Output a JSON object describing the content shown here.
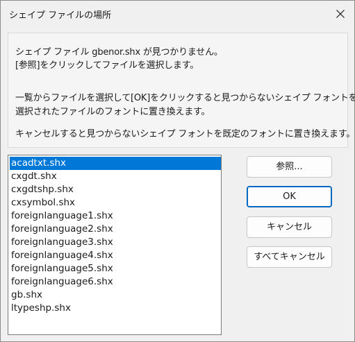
{
  "window": {
    "title": "シェイプ ファイルの場所",
    "close_icon": "close-icon"
  },
  "message": {
    "line1": "シェイプ ファイル gbenor.shx が見つかりません。",
    "line2": "[参照]をクリックしてファイルを選択します。",
    "line3": "一覧からファイルを選択して[OK]をクリックすると見つからないシェイプ フォントを",
    "line4": "選択されたファイルのフォントに置き換えます。",
    "line5": "キャンセルすると見つからないシェイプ フォントを既定のフォントに置き換えます。"
  },
  "file_list": {
    "items": [
      "acadtxt.shx",
      "cxgdt.shx",
      "cxgdtshp.shx",
      "cxsymbol.shx",
      "foreignlanguage1.shx",
      "foreignlanguage2.shx",
      "foreignlanguage3.shx",
      "foreignlanguage4.shx",
      "foreignlanguage5.shx",
      "foreignlanguage6.shx",
      "gb.shx",
      "ltypeshp.shx"
    ],
    "selected_index": 0
  },
  "buttons": {
    "browse": "参照...",
    "ok": "OK",
    "cancel": "キャンセル",
    "cancel_all": "すべてキャンセル"
  },
  "colors": {
    "selection": "#0078d7",
    "default_button_border": "#0067c0"
  }
}
